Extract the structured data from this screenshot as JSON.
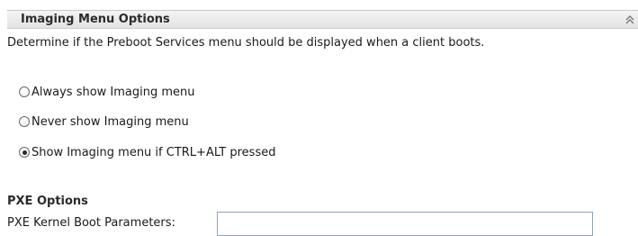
{
  "section": {
    "title": "Imaging Menu Options",
    "collapse_icon": "double-chevron-up-icon",
    "description": "Determine if the Preboot Services menu should be displayed when a client boots."
  },
  "menu_display": {
    "options": [
      {
        "label": "Always show Imaging menu",
        "checked": false
      },
      {
        "label": "Never show Imaging menu",
        "checked": false
      },
      {
        "label": "Show Imaging menu if CTRL+ALT pressed",
        "checked": true
      }
    ]
  },
  "pxe": {
    "heading": "PXE Options",
    "kernel_boot_params_label": "PXE Kernel Boot Parameters:",
    "kernel_boot_params_value": ""
  },
  "colors": {
    "header_background": "#e9e9e9",
    "input_border": "#8fa3bf"
  }
}
